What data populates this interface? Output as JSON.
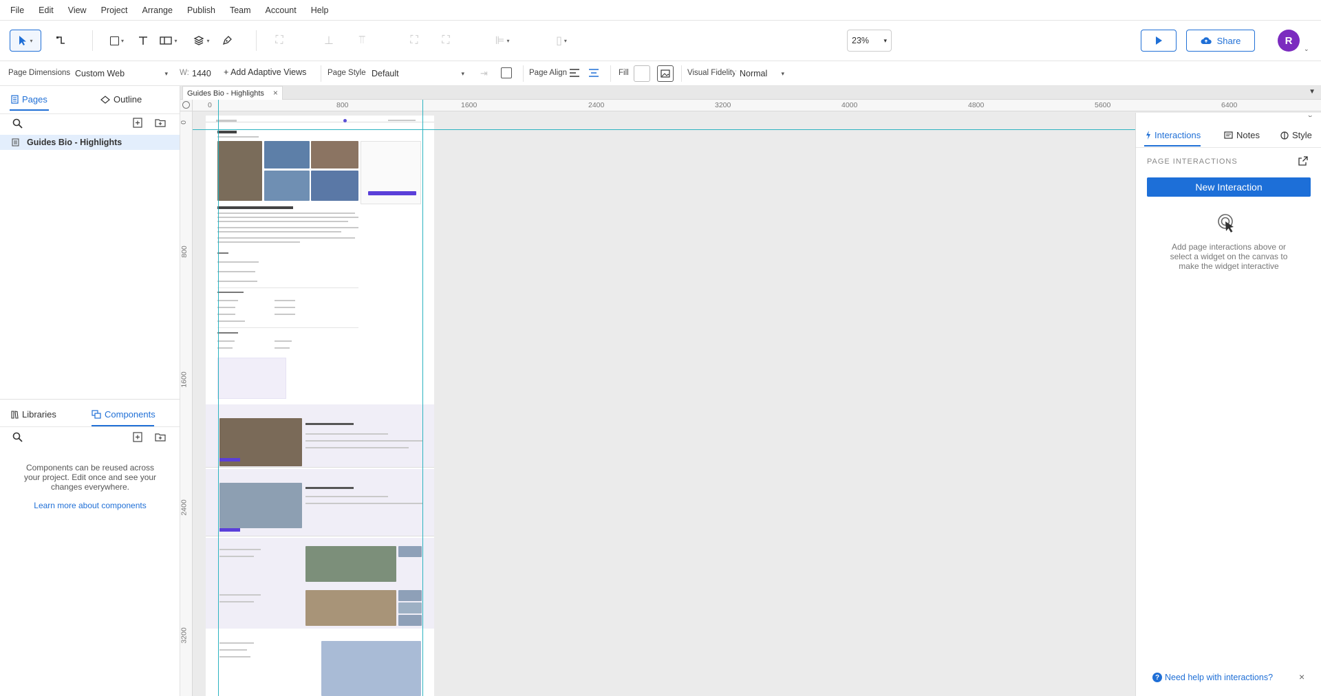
{
  "menu": [
    "File",
    "Edit",
    "View",
    "Project",
    "Arrange",
    "Publish",
    "Team",
    "Account",
    "Help"
  ],
  "toolbar": {
    "zoom": "23%",
    "share_label": "Share",
    "avatar_initial": "R"
  },
  "propbar": {
    "page_dimensions_label": "Page Dimensions",
    "page_dimensions_value": "Custom Web",
    "width_label": "W:",
    "width_value": "1440",
    "adaptive_label": "+ Add Adaptive Views",
    "page_style_label": "Page Style",
    "page_style_value": "Default",
    "page_align_label": "Page Align",
    "fill_label": "Fill",
    "visual_fidelity_label": "Visual Fidelity",
    "visual_fidelity_value": "Normal"
  },
  "left": {
    "tabs": [
      "Pages",
      "Outline"
    ],
    "pages": [
      "Guides Bio - Highlights"
    ],
    "bottom_tabs": [
      "Libraries",
      "Components"
    ],
    "components_empty": "Components can be reused across your project. Edit once and see your changes everywhere.",
    "learn_more": "Learn more about components"
  },
  "canvas": {
    "doc_tab": "Guides Bio - Highlights",
    "ruler_top": [
      "0",
      "800",
      "1600",
      "2400",
      "3200",
      "4000",
      "4800",
      "5600",
      "6400"
    ],
    "ruler_left": [
      "0",
      "800",
      "1600",
      "2400",
      "3200"
    ]
  },
  "right": {
    "tabs": [
      "Interactions",
      "Notes",
      "Style"
    ],
    "section_title": "PAGE INTERACTIONS",
    "new_interaction": "New Interaction",
    "empty_hint": "Add page interactions above or select a widget on the canvas to make the widget interactive",
    "help_link": "Need help with interactions?"
  },
  "colors": {
    "accent": "#1f6fd6",
    "avatar": "#7b2bbf",
    "canvas_bg": "#ebebeb",
    "guide": "#2bb3c0"
  }
}
